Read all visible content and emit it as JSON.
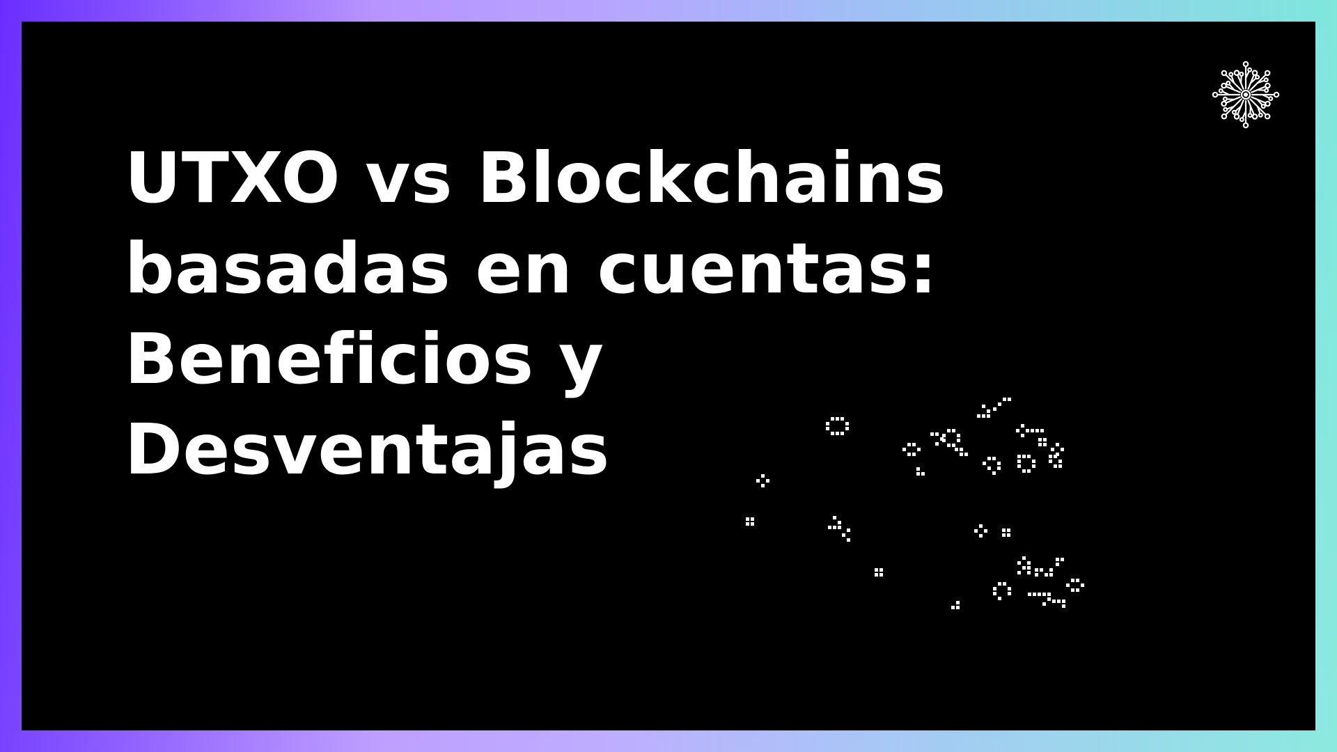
{
  "slide": {
    "title_lines": [
      "UTXO vs Blockchains",
      "basadas en cuentas:",
      "Beneficios y",
      "Desventajas"
    ]
  },
  "icons": {
    "logo": "network-burst-icon",
    "decoration": "pixel-cellular-pattern"
  },
  "colors": {
    "background": "#000000",
    "text": "#ffffff",
    "border_gradient": [
      "#6a2dff",
      "#b794ff",
      "#9fc0f5",
      "#7fe7dc"
    ]
  }
}
